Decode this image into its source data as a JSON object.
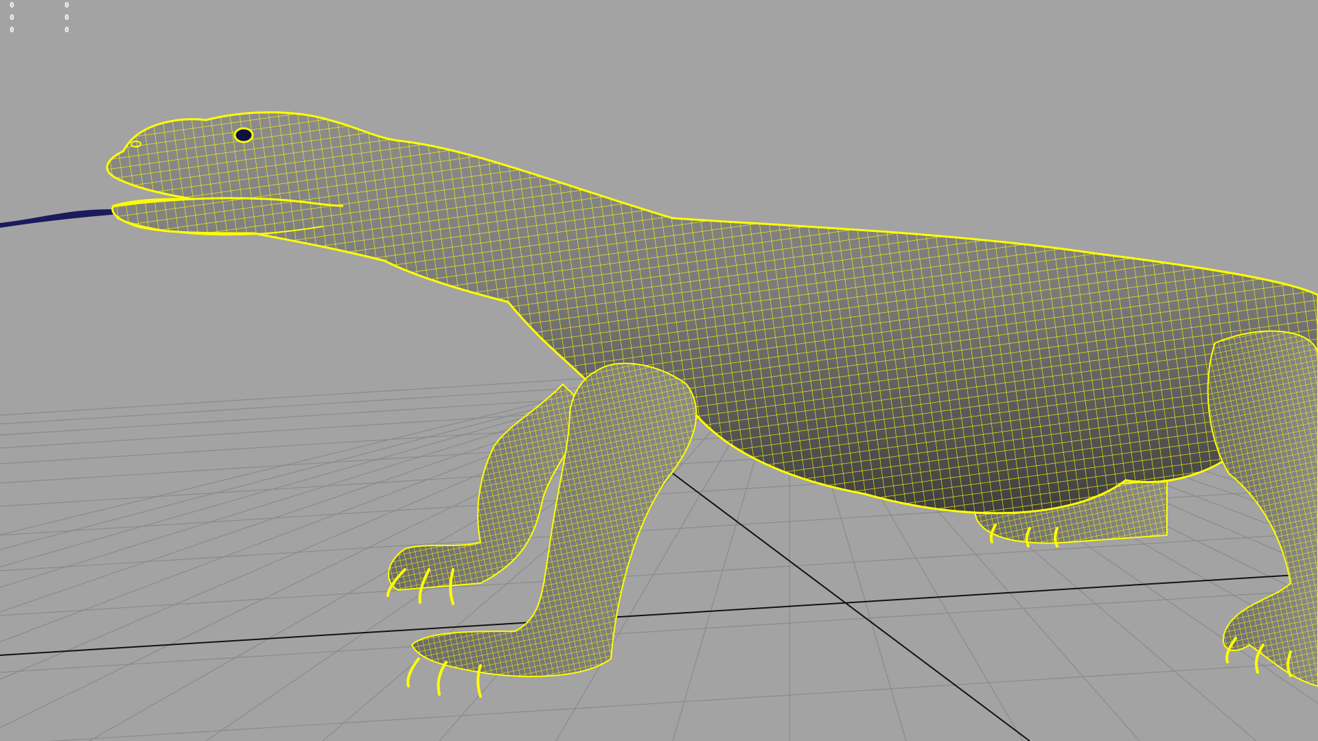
{
  "viewport": {
    "background_color": "#a3a3a3",
    "grid_color": "#8a8a8a",
    "axis_color": "#111111",
    "wireframe_color": "#ffff00",
    "shaded_surface_color": "#707070",
    "tongue_color": "#1a1a5c",
    "eye_color": "#101040"
  },
  "hud": {
    "rows": [
      [
        "0",
        "0"
      ],
      [
        "0",
        "0"
      ],
      [
        "0",
        "0"
      ]
    ]
  },
  "model": {
    "subject": "komodo-dragon",
    "display_mode": "wireframe-on-shaded"
  }
}
